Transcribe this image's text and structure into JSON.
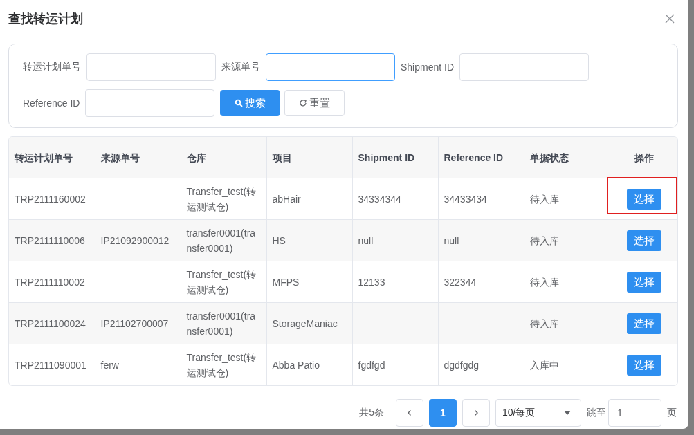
{
  "dialog": {
    "title": "查找转运计划"
  },
  "search": {
    "fields": [
      {
        "label": "转运计划单号",
        "focused": false
      },
      {
        "label": "来源单号",
        "focused": true
      },
      {
        "label": "Shipment ID",
        "focused": false
      },
      {
        "label": "Reference ID",
        "focused": false
      }
    ],
    "buttons": [
      {
        "label": "搜索",
        "kind": "primary"
      },
      {
        "label": "重置",
        "kind": "reset"
      }
    ]
  },
  "table": {
    "columns": [
      "转运计划单号",
      "来源单号",
      "仓库",
      "项目",
      "Shipment ID",
      "Reference ID",
      "单据状态",
      "操作"
    ],
    "rows": [
      {
        "cells": [
          "TRP2111160002",
          "",
          "Transfer_test(转运测试仓)",
          "abHair",
          "34334344",
          "34433434",
          "待入库"
        ],
        "action": "选择",
        "highlighted": true
      },
      {
        "cells": [
          "TRP2111110006",
          "IP21092900012",
          "transfer0001(transfer0001)",
          "HS",
          "null",
          "null",
          "待入库"
        ],
        "action": "选择",
        "highlighted": false
      },
      {
        "cells": [
          "TRP2111110002",
          "",
          "Transfer_test(转运测试仓)",
          "MFPS",
          "12133",
          "322344",
          "待入库"
        ],
        "action": "选择",
        "highlighted": false
      },
      {
        "cells": [
          "TRP2111100024",
          "IP21102700007",
          "transfer0001(transfer0001)",
          "StorageManiac",
          "",
          "",
          "待入库"
        ],
        "action": "选择",
        "highlighted": false
      },
      {
        "cells": [
          "TRP2111090001",
          "ferw",
          "Transfer_test(转运测试仓)",
          "Abba Patio",
          "fgdfgd",
          "dgdfgdg",
          "入库中"
        ],
        "action": "选择",
        "highlighted": false
      }
    ]
  },
  "pagination": {
    "total": "共5条",
    "pages": [
      {
        "label": "1",
        "selected": true
      }
    ],
    "page_size": "10/每页",
    "jump_label": "跳至",
    "jump_value": "1",
    "page_unit": "页"
  }
}
